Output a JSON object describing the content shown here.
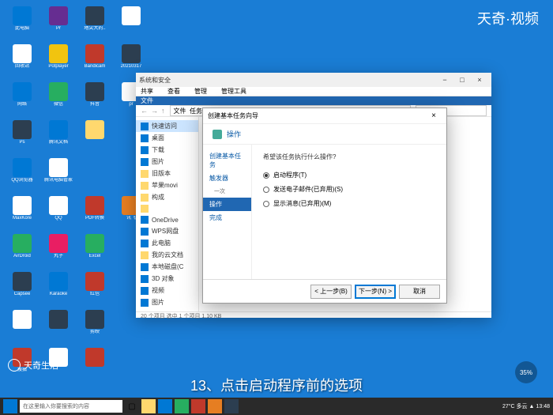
{
  "watermark": {
    "main": "天奇·视频",
    "sub": "天奇生活"
  },
  "subtitle": "13、点击启动程序前的选项",
  "progress": "35%",
  "desktop_icons": [
    {
      "label": "此电脑",
      "bg": "i-blue"
    },
    {
      "label": "Pr",
      "bg": "i-purple"
    },
    {
      "label": "地尖大的..",
      "bg": "i-dark"
    },
    {
      "label": "",
      "bg": "i-white"
    },
    {
      "label": "回收站",
      "bg": "i-white"
    },
    {
      "label": "Potplayer",
      "bg": "i-yellow"
    },
    {
      "label": "Bandicam",
      "bg": "i-red"
    },
    {
      "label": "20210317",
      "bg": "i-dark"
    },
    {
      "label": "网络",
      "bg": "i-blue"
    },
    {
      "label": "微信",
      "bg": "i-green"
    },
    {
      "label": "抖音",
      "bg": "i-dark"
    },
    {
      "label": "pr",
      "bg": "i-white"
    },
    {
      "label": "Ps",
      "bg": "i-dark"
    },
    {
      "label": "腾讯文档",
      "bg": "i-blue"
    },
    {
      "label": "",
      "bg": "i-folder"
    },
    {
      "label": "",
      "bg": ""
    },
    {
      "label": "QQ浏览器",
      "bg": "i-blue"
    },
    {
      "label": "腾讯电脑管家",
      "bg": "i-white"
    },
    {
      "label": "",
      "bg": ""
    },
    {
      "label": "",
      "bg": ""
    },
    {
      "label": "MaxKore",
      "bg": "i-white"
    },
    {
      "label": "QQ",
      "bg": "i-white"
    },
    {
      "label": "PDF转换",
      "bg": "i-red"
    },
    {
      "label": "讯飞",
      "bg": "i-orange"
    },
    {
      "label": "AirDroid",
      "bg": "i-green"
    },
    {
      "label": "丸子",
      "bg": "i-pink"
    },
    {
      "label": "Excel",
      "bg": "i-green"
    },
    {
      "label": "",
      "bg": ""
    },
    {
      "label": "Capsee",
      "bg": "i-dark"
    },
    {
      "label": "Karaoke",
      "bg": "i-blue"
    },
    {
      "label": "红包",
      "bg": "i-red"
    },
    {
      "label": "",
      "bg": ""
    },
    {
      "label": "",
      "bg": "i-white"
    },
    {
      "label": "",
      "bg": "i-dark"
    },
    {
      "label": "剪映",
      "bg": "i-dark"
    },
    {
      "label": "",
      "bg": ""
    },
    {
      "label": "搜狐",
      "bg": "i-red"
    },
    {
      "label": "",
      "bg": "i-white"
    },
    {
      "label": "",
      "bg": "i-red"
    },
    {
      "label": "",
      "bg": ""
    }
  ],
  "explorer": {
    "title": "系统和安全",
    "tabs": [
      "共享",
      "查看",
      "管理",
      "管理工具"
    ],
    "ribbon_label": "文件",
    "address_nav": [
      "文件",
      "任务"
    ],
    "sidebar": [
      {
        "label": "快速访问",
        "icon": "i-blue",
        "active": true
      },
      {
        "label": "桌面",
        "icon": "i-blue"
      },
      {
        "label": "下载",
        "icon": "i-blue"
      },
      {
        "label": "图片",
        "icon": "i-blue"
      },
      {
        "label": "旧版本",
        "icon": "i-folder"
      },
      {
        "label": "苹果movi",
        "icon": "i-folder"
      },
      {
        "label": "构成",
        "icon": "i-folder"
      },
      {
        "label": "",
        "icon": "i-folder"
      },
      {
        "label": "OneDrive",
        "icon": "i-blue"
      },
      {
        "label": "WPS网盘",
        "icon": "i-blue"
      },
      {
        "label": "此电脑",
        "icon": "i-blue"
      },
      {
        "label": "我的云文档",
        "icon": "i-folder"
      },
      {
        "label": "本地磁盘(C",
        "icon": "i-blue"
      },
      {
        "label": "3D 对象",
        "icon": "i-blue"
      },
      {
        "label": "视频",
        "icon": "i-blue"
      },
      {
        "label": "图片",
        "icon": "i-blue"
      }
    ],
    "status": "20 个项目  选中 1 个项目 1.10 KB"
  },
  "wizard": {
    "title": "创建基本任务向导",
    "header": "操作",
    "steps": [
      {
        "label": "创建基本任务",
        "active": false
      },
      {
        "label": "触发器",
        "active": false
      },
      {
        "label": "一次",
        "active": false,
        "sub": true
      },
      {
        "label": "操作",
        "active": true
      },
      {
        "label": "完成",
        "active": false
      }
    ],
    "prompt": "希望该任务执行什么操作?",
    "options": [
      {
        "label": "启动程序(T)",
        "checked": true
      },
      {
        "label": "发送电子邮件(已弃用)(S)",
        "checked": false
      },
      {
        "label": "显示消息(已弃用)(M)",
        "checked": false
      }
    ],
    "buttons": {
      "back": "< 上一步(B)",
      "next": "下一步(N) >",
      "cancel": "取消"
    }
  },
  "taskbar": {
    "search_placeholder": "在这里输入你要搜索的内容",
    "weather": "27°C 多云",
    "time": "13:48"
  }
}
